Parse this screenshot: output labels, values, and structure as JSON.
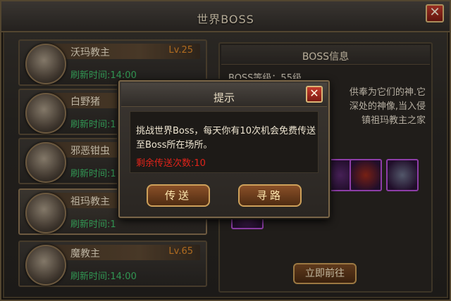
{
  "window": {
    "title": "世界BOSS",
    "close_label": "✕"
  },
  "boss_list": [
    {
      "name": "沃玛教主",
      "level": "Lv.25",
      "refresh": "刷新时间:14:00"
    },
    {
      "name": "白野猪",
      "level": "",
      "refresh": "刷新时间:1"
    },
    {
      "name": "邪恶钳虫",
      "level": "",
      "refresh": "刷新时间:1"
    },
    {
      "name": "祖玛教主",
      "level": "",
      "refresh": "刷新时间:1"
    },
    {
      "name": "魔教主",
      "level": "Lv.65",
      "refresh": "刷新时间:14:00"
    }
  ],
  "info_panel": {
    "header": "BOSS信息",
    "line1": "BOSS等级：55级",
    "line2_right": "供奉为它们的神.它",
    "line3_right": "深处的神像,当入侵",
    "line4_right": "镇祖玛教主之家",
    "go_button": "立即前往"
  },
  "dialog": {
    "title": "提示",
    "close_label": "✕",
    "message": "挑战世界Boss，每天你有10次机会免费传送至Boss所在场所。",
    "remaining": "剩余传送次数:10",
    "teleport_button": "传送",
    "pathfind_button": "寻路"
  },
  "colors": {
    "level": "#e08a2a",
    "refresh": "#3fbf6a",
    "warning": "#e0231a",
    "item_border": "#b54fd6"
  }
}
